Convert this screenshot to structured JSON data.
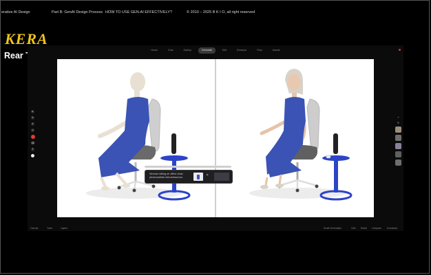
{
  "header": {
    "course_label": "erative AI Design",
    "part_label": "Part B: GenAI Design Process",
    "lesson_label": "HOW TO USE GEN-AI EFFECTIVELY?",
    "copyright": "© 2010 – 2025  B K I O, all right reserved"
  },
  "brand": {
    "logo_text": "KERA"
  },
  "slide": {
    "subtitle": "Rear Time Generate"
  },
  "app": {
    "tabs": [
      {
        "label": "Home"
      },
      {
        "label": "Chat"
      },
      {
        "label": "Gallery"
      },
      {
        "label": "Generate"
      },
      {
        "label": "Edit"
      },
      {
        "label": "Enhance"
      },
      {
        "label": "Flow"
      },
      {
        "label": "Assets"
      }
    ],
    "active_tab_index": 3,
    "prompt_text": "Woman sitting on office chair, photorealistic #shoebrauncw",
    "bottom": {
      "left_items": [
        "Canvas",
        "Tools",
        "Layers"
      ],
      "right_items": [
        "Scale Generation",
        "Grid",
        "Reset",
        "Compare",
        "Download"
      ]
    }
  },
  "colors": {
    "accent_yellow": "#f0c419",
    "dress_blue": "#3b53b4"
  }
}
